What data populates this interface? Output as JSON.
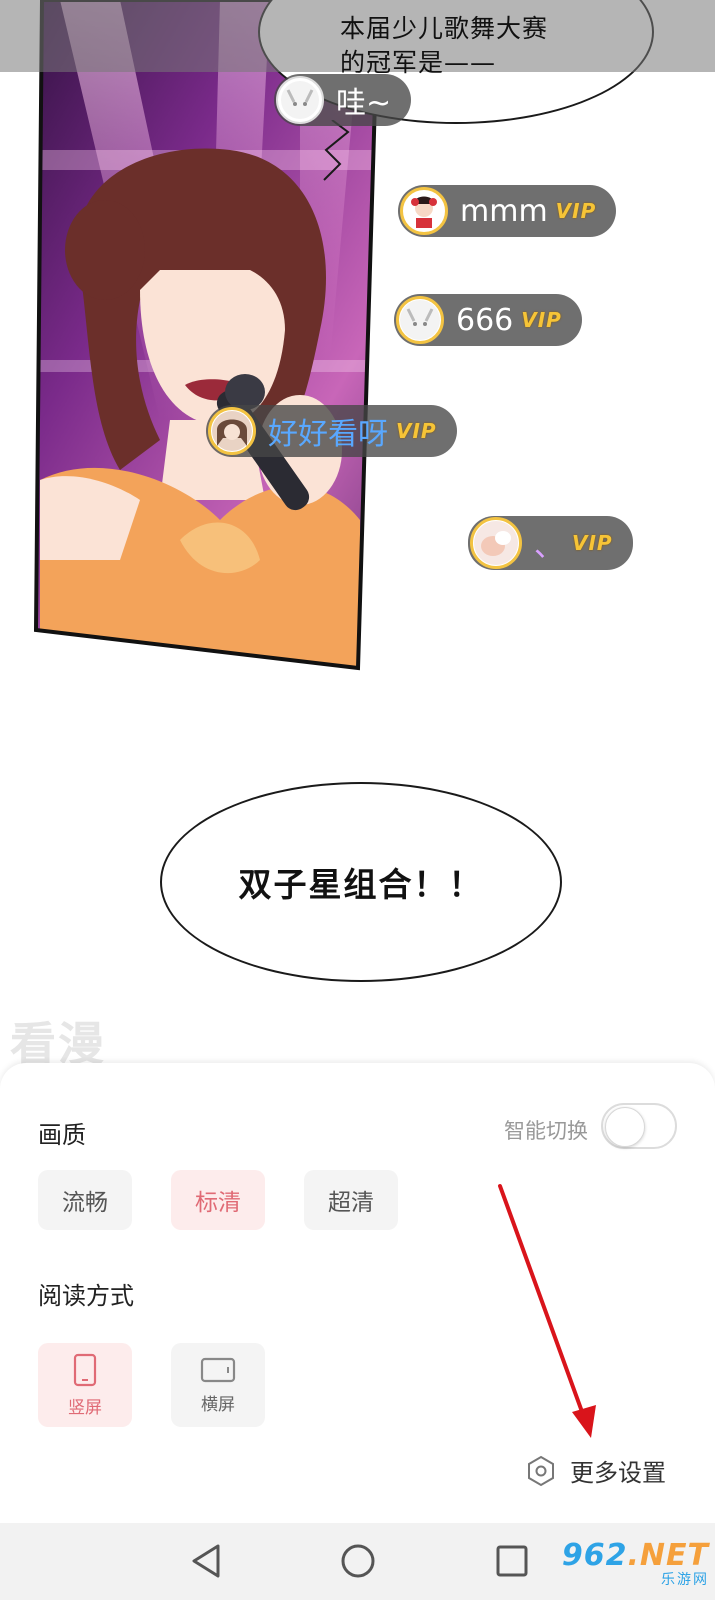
{
  "comic": {
    "bubble_top_lines": [
      "本届少儿歌舞大赛",
      "的冠军是——"
    ],
    "bubble_bottom": "双子星组合！！",
    "watermark": "看漫"
  },
  "danmaku": [
    {
      "text": "哇~",
      "vip": false,
      "highlight": false
    },
    {
      "text": "mmm",
      "vip": true,
      "highlight": false
    },
    {
      "text": "666",
      "vip": true,
      "highlight": false
    },
    {
      "text": "好好看呀",
      "vip": true,
      "highlight": true
    },
    {
      "text": "、",
      "vip": true,
      "highlight": false
    }
  ],
  "vip_badge": "VIP",
  "settings": {
    "quality_title": "画质",
    "smart_switch_label": "智能切换",
    "smart_switch_on": false,
    "quality_options": [
      {
        "label": "流畅",
        "selected": false
      },
      {
        "label": "标清",
        "selected": true
      },
      {
        "label": "超清",
        "selected": false
      }
    ],
    "reading_title": "阅读方式",
    "reading_modes": [
      {
        "label": "竖屏",
        "icon": "phone-portrait-icon",
        "selected": true
      },
      {
        "label": "横屏",
        "icon": "phone-landscape-icon",
        "selected": false
      }
    ],
    "more_settings_label": "更多设置",
    "more_settings_icon": "hexagon-settings-icon"
  },
  "colors": {
    "accent": "#e06a75",
    "accent_bg": "#fdecec",
    "annotation_arrow": "#d9141b"
  },
  "brand": {
    "name_left": "962",
    "name_right": ".NET",
    "subtitle": "乐游网"
  }
}
